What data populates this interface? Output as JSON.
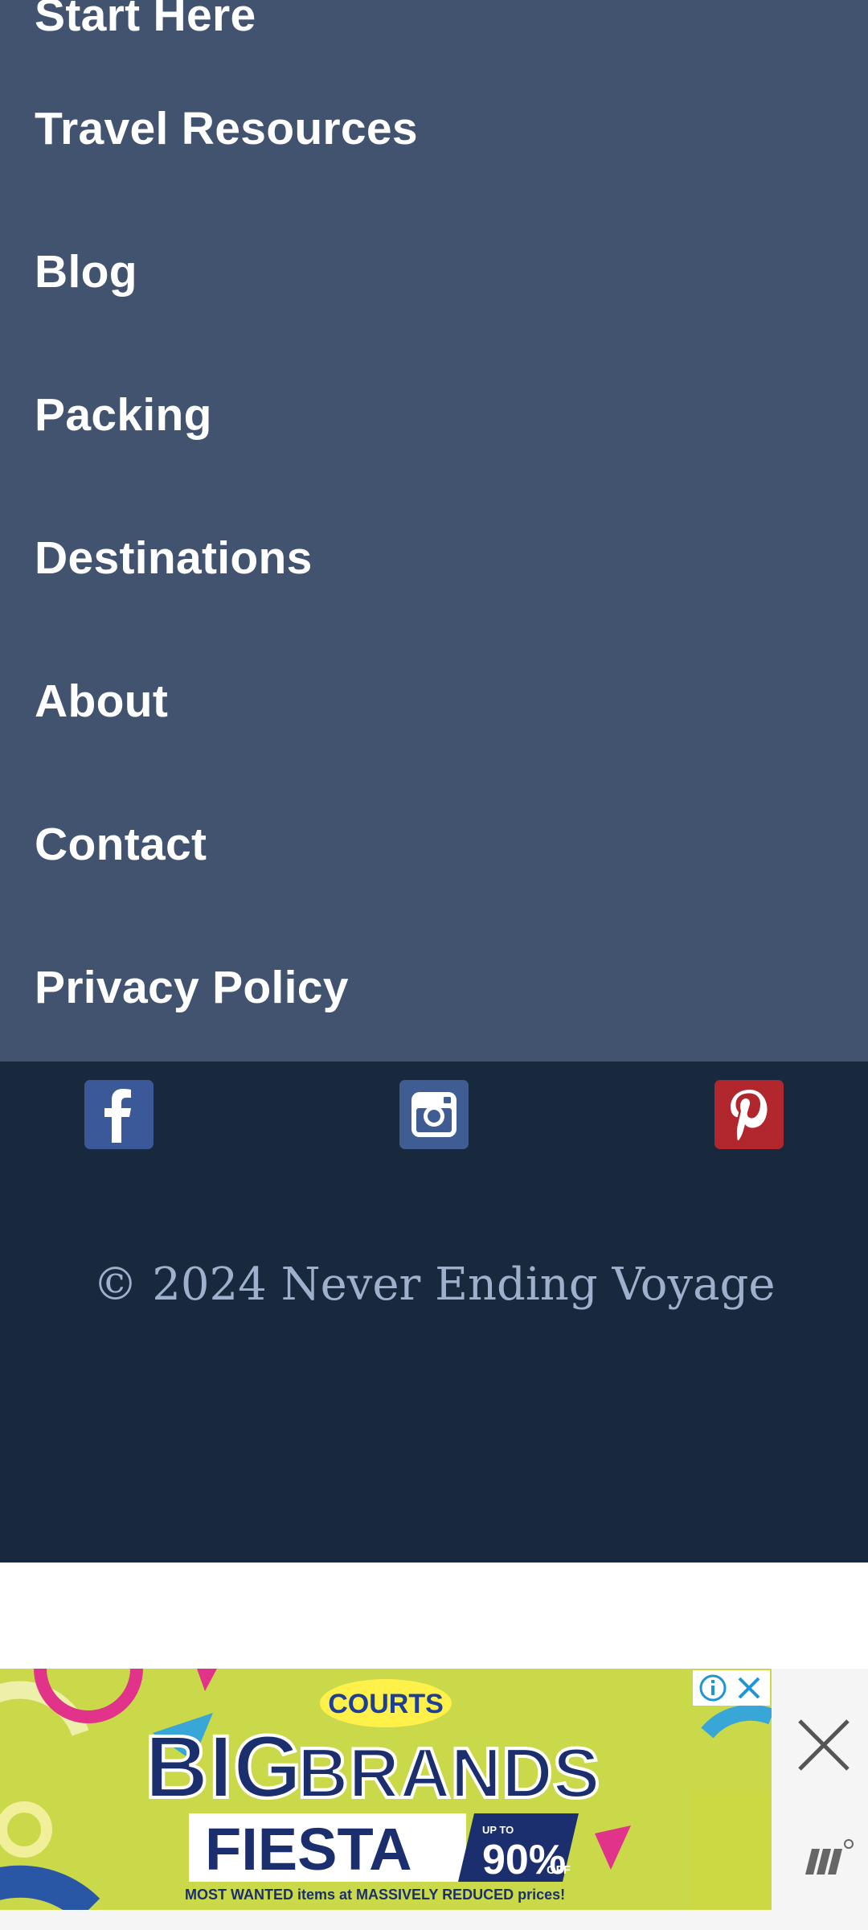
{
  "menu": {
    "items": [
      {
        "label": "Start Here"
      },
      {
        "label": "Travel Resources"
      },
      {
        "label": "Blog"
      },
      {
        "label": "Packing"
      },
      {
        "label": "Destinations"
      },
      {
        "label": "About"
      },
      {
        "label": "Contact"
      },
      {
        "label": "Privacy Policy"
      }
    ]
  },
  "footer": {
    "social": [
      {
        "name": "facebook-icon",
        "color": "#3b5998"
      },
      {
        "name": "instagram-icon",
        "color": "#3f5c93"
      },
      {
        "name": "pinterest-icon",
        "color": "#b2262d"
      }
    ],
    "copyright": "© 2024 Never Ending Voyage"
  },
  "ad": {
    "brand": "COURTS",
    "headline_1": "BIG",
    "headline_2": "BRANDS",
    "headline_3": "FIESTA",
    "discount_prefix": "UP TO",
    "discount_value": "90%",
    "discount_suffix": "OFF",
    "tagline": "MOST WANTED items at MASSIVELY REDUCED prices!",
    "background_color": "#c9d94a"
  }
}
